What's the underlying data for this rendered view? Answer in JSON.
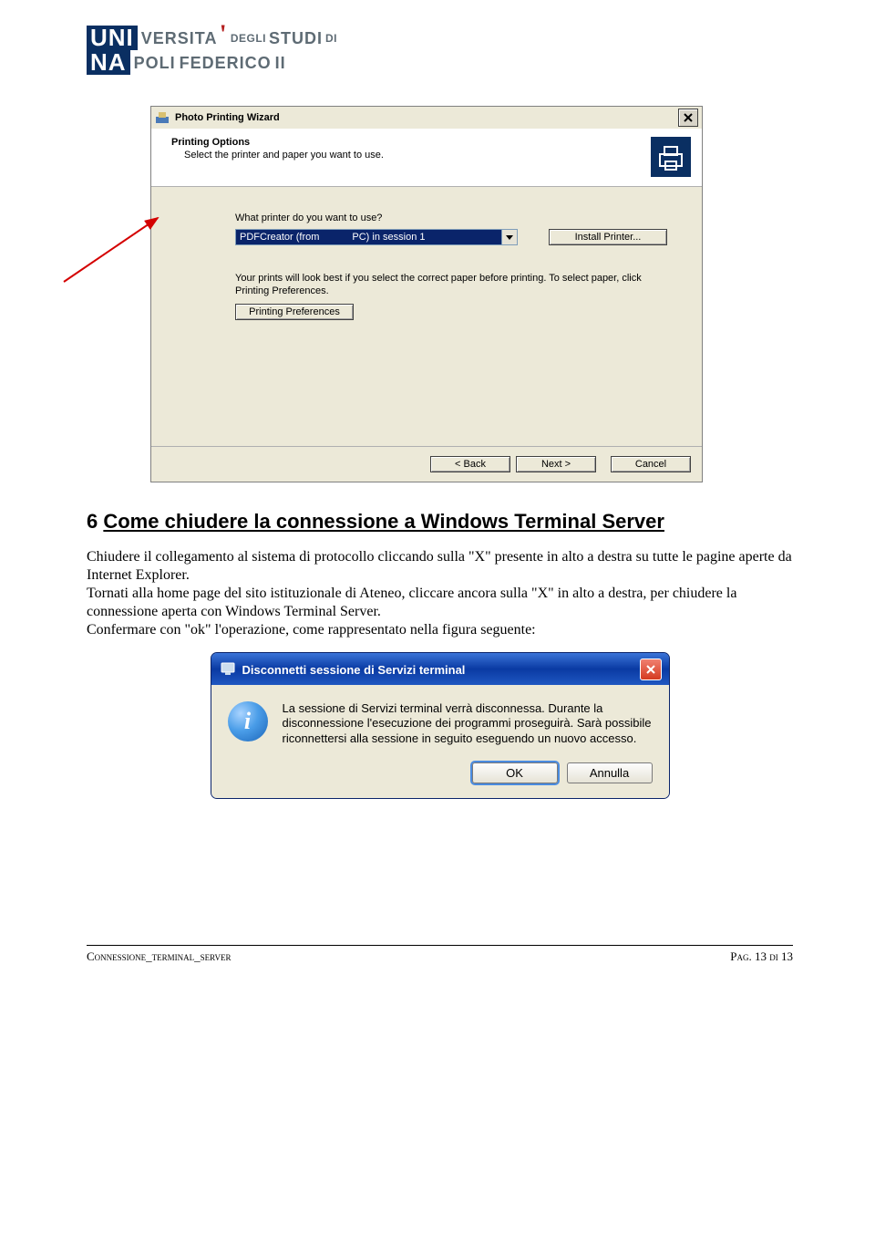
{
  "logo": {
    "l1_box": "UNI",
    "l1_rest_big": "VERSITA",
    "l1_rest_small": "DEGLI",
    "l1_rest_big2": "STUDI",
    "l1_rest_small2": "DI",
    "l2_box": "NA",
    "l2_rest_big": "POLI",
    "l2_rest_big2": "FEDERICO",
    "l2_rest_big3": "II"
  },
  "wizard": {
    "window_title": "Photo Printing Wizard",
    "header_title": "Printing Options",
    "header_sub": "Select the printer and paper you want to use.",
    "question": "What printer do you want to use?",
    "dd_part1": "PDFCreator (from",
    "dd_part2": "PC) in session 1",
    "install_btn": "Install Printer...",
    "hint1": "Your prints will look best if you select the correct paper before printing. To select paper, click",
    "hint2": "Printing Preferences.",
    "prefs_btn": "Printing Preferences",
    "back_btn": "< Back",
    "next_btn": "Next >",
    "cancel_btn": "Cancel"
  },
  "section": {
    "num": "6 ",
    "title": "Come chiudere la connessione a Windows Terminal Server",
    "p1": "Chiudere il collegamento al sistema di protocollo cliccando sulla \"X\" presente in alto a destra su tutte le pagine aperte da Internet Explorer.",
    "p2": "Tornati alla home page del sito istituzionale di Ateneo, cliccare ancora sulla \"X\" in alto a destra, per chiudere la connessione aperta con Windows Terminal Server.",
    "p3": "Confermare con \"ok\" l'operazione, come rappresentato nella figura seguente:"
  },
  "dialog": {
    "title": "Disconnetti sessione di Servizi terminal",
    "body": "La sessione di Servizi terminal verrà disconnessa. Durante la disconnessione l'esecuzione dei programmi proseguirà. Sarà possibile riconnettersi alla sessione in seguito eseguendo un nuovo accesso.",
    "ok": "OK",
    "cancel": "Annulla"
  },
  "footer": {
    "left": "Connessione_terminal_server",
    "right_label": "Pag. ",
    "right_page": "13",
    "right_sep": " di ",
    "right_total": "13"
  }
}
